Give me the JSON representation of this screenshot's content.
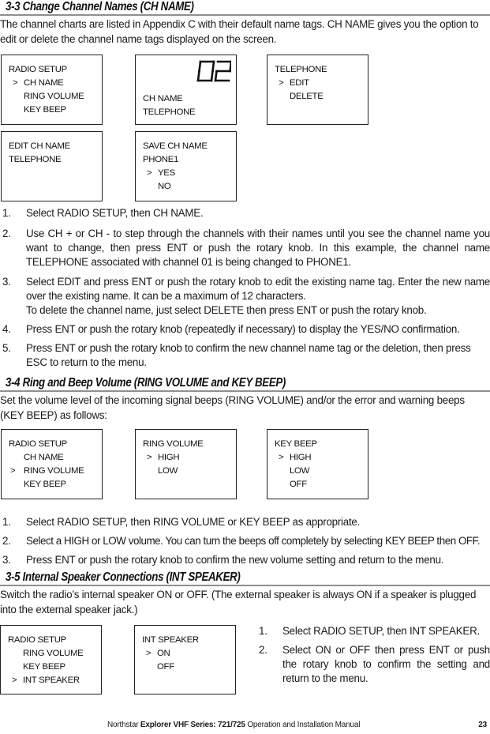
{
  "sections": [
    {
      "title": "3-3  Change Channel Names (CH NAME)",
      "intro": "The channel charts are listed in Appendix C with their default name tags. CH NAME gives you the option to edit or delete the channel name tags displayed on the screen.",
      "screens": [
        {
          "lines": [
            "RADIO SETUP",
            "CH NAME",
            "RING VOLUME",
            "KEY BEEP"
          ],
          "selected": 1
        },
        {
          "channel_display": "02",
          "lines": [
            "CH NAME",
            "TELEPHONE"
          ]
        },
        {
          "lines": [
            "TELEPHONE",
            "EDIT",
            "DELETE"
          ],
          "selected": 1
        },
        {
          "lines": [
            "EDIT CH NAME",
            "TELEPHONE"
          ]
        },
        {
          "lines": [
            "SAVE CH NAME",
            "PHONE1",
            "YES",
            "NO"
          ],
          "selected": 2
        }
      ],
      "steps": [
        {
          "num": "1.",
          "text": "Select RADIO SETUP, then CH NAME."
        },
        {
          "num": "2.",
          "text": "Use CH + or CH - to step through the channels with their names until you see the channel name you want to change, then press ENT or push the rotary knob. In this example, the channel name TELEPHONE associated with channel 01 is being changed to PHONE1."
        },
        {
          "num": "3.",
          "text": "Select EDIT and press ENT or push the rotary knob to edit the existing name tag. Enter the new name over the existing name. It can be a maximum of 12 characters."
        },
        {
          "num": "",
          "text": "To delete the channel name, just select DELETE then press ENT or push the rotary knob."
        },
        {
          "num": "4.",
          "text": "Press ENT or push the rotary knob (repeatedly if necessary) to display the YES/NO confirmation."
        },
        {
          "num": "5.",
          "text": "Press ENT or push the rotary knob to confirm the new channel name tag or the deletion, then press ESC to return to the menu."
        }
      ]
    },
    {
      "title": "3-4 Ring and Beep Volume  (RING VOLUME and KEY BEEP)",
      "intro": "Set the volume level of the incoming signal beeps (RING VOLUME) and/or the error and warning beeps (KEY BEEP) as follows:",
      "screens": [
        {
          "lines": [
            "RADIO SETUP",
            "CH NAME",
            "RING VOLUME",
            "KEY BEEP"
          ],
          "selected": 2
        },
        {
          "lines": [
            "RING VOLUME",
            "HIGH",
            "LOW"
          ],
          "selected": 1
        },
        {
          "lines": [
            "KEY BEEP",
            "HIGH",
            "LOW",
            "OFF"
          ],
          "selected": 1
        }
      ],
      "steps": [
        {
          "num": "1.",
          "text": "Select RADIO SETUP, then RING VOLUME or KEY BEEP as appropriate."
        },
        {
          "num": "2.",
          "text": "Select a HIGH or LOW volume. You can turn the beeps off completely by selecting KEY BEEP then OFF."
        },
        {
          "num": "3.",
          "text": "Press ENT or push the rotary knob to confirm the new volume setting and return to the menu."
        }
      ]
    },
    {
      "title": "3-5 Internal Speaker Connections (INT SPEAKER)",
      "intro": "Switch the radio’s internal speaker ON or OFF. (The external speaker is always ON if a speaker is plugged into the external speaker jack.)",
      "screens": [
        {
          "lines": [
            "RADIO SETUP",
            "RING VOLUME",
            "KEY BEEP",
            "INT SPEAKER"
          ],
          "selected": 3
        },
        {
          "lines": [
            "INT SPEAKER",
            "ON",
            "OFF"
          ],
          "selected": 1
        }
      ],
      "steps": [
        {
          "num": "1.",
          "text": "Select RADIO SETUP, then INT SPEAKER."
        },
        {
          "num": "2.",
          "text": "Select ON or OFF then press ENT or push the rotary knob to confirm the setting and return to the menu."
        }
      ]
    }
  ],
  "selector_glyph": ">",
  "footer": {
    "brand": "Northstar",
    "product": "Explorer VHF Series: 721/725",
    "suffix": "Operation and Installation Manual",
    "page_number": "23"
  }
}
